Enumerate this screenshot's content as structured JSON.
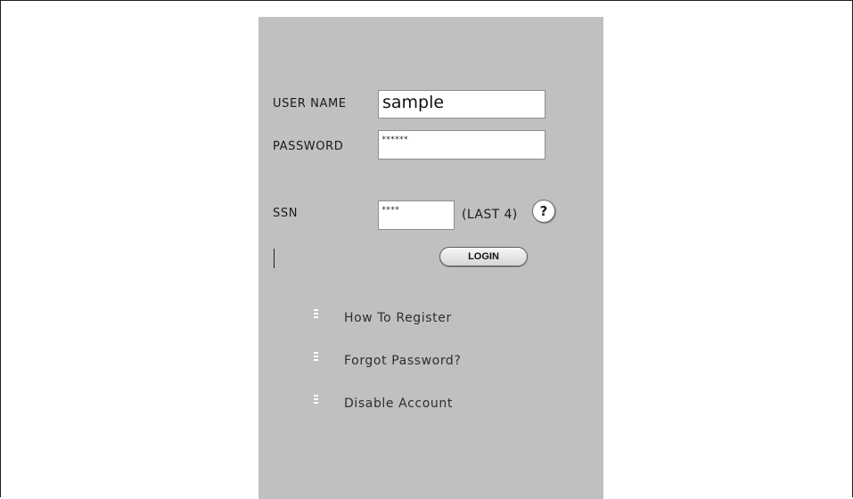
{
  "login_form": {
    "username_label": "USER NAME",
    "username_value": "sample",
    "password_label": "PASSWORD",
    "password_mask": "******",
    "ssn_label": "SSN",
    "ssn_mask": "****",
    "ssn_hint": "(LAST 4)",
    "help_symbol": "?",
    "login_button": "LOGIN"
  },
  "links": [
    {
      "label": "How To Register"
    },
    {
      "label": "Forgot Password?"
    },
    {
      "label": "Disable Account"
    }
  ],
  "colors": {
    "panel_background": "#c0c0c0",
    "page_background": "#ffffff",
    "field_background": "#ffffff"
  }
}
